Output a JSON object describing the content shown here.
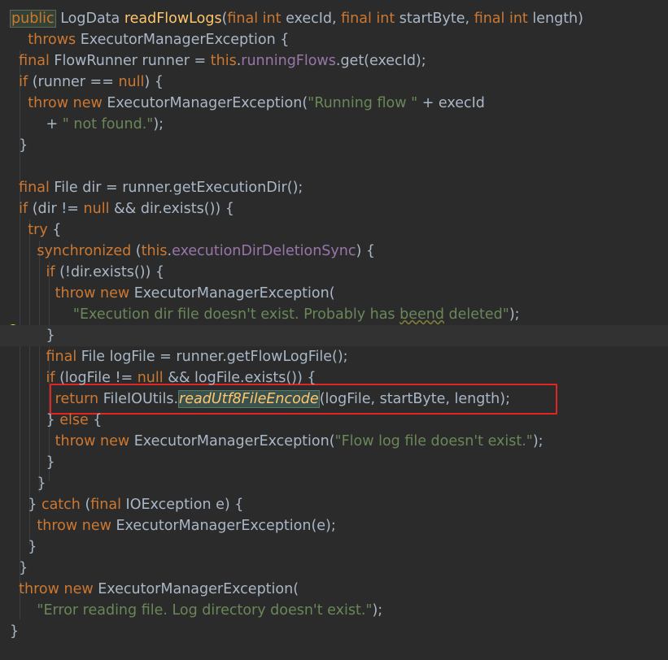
{
  "code_lines": [
    "public LogData readFlowLogs(final int execId, final int startByte, final int length)",
    "    throws ExecutorManagerException {",
    "  final FlowRunner runner = this.runningFlows.get(execId);",
    "  if (runner == null) {",
    "    throw new ExecutorManagerException(\"Running flow \" + execId",
    "        + \" not found.\");",
    "  }",
    "",
    "  final File dir = runner.getExecutionDir();",
    "  if (dir != null && dir.exists()) {",
    "    try {",
    "      synchronized (this.executionDirDeletionSync) {",
    "        if (!dir.exists()) {",
    "          throw new ExecutorManagerException(",
    "              \"Execution dir file doesn't exist. Probably has beend deleted\");",
    "        }",
    "        final File logFile = runner.getFlowLogFile();",
    "        if (logFile != null && logFile.exists()) {",
    "          return FileIOUtils.readUtf8FileEncode(logFile, startByte, length);",
    "        } else {",
    "          throw new ExecutorManagerException(\"Flow log file doesn't exist.\");",
    "        }",
    "      }",
    "    } catch (final IOException e) {",
    "      throw new ExecutorManagerException(e);",
    "    }",
    "  }",
    "  throw new ExecutorManagerException(",
    "      \"Error reading file. Log directory doesn't exist.\");",
    "}"
  ],
  "theme": {
    "background": "#2b2b2b",
    "keyword": "#cc7832",
    "method_decl": "#ffc66d",
    "field": "#9876aa",
    "string": "#6a8759",
    "text": "#a9b7c6",
    "highlight_box": "#e02525"
  },
  "gutter": {
    "intention_icon": "lightbulb-icon"
  }
}
